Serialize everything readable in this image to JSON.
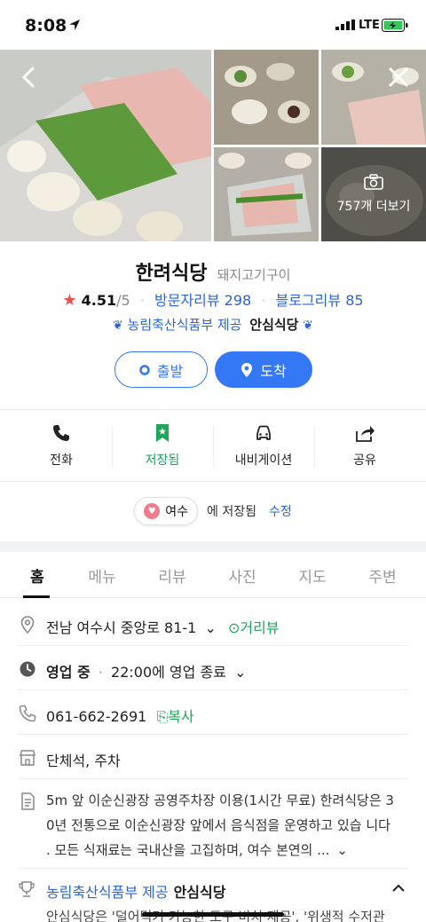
{
  "status_bar": {
    "time": "8:08",
    "network": "LTE"
  },
  "gallery": {
    "more_label": "757개 더보기"
  },
  "place": {
    "name": "한려식당",
    "category": "돼지고기구이",
    "rating": "4.51",
    "rating_max": "/5",
    "visitor_review_label": "방문자리뷰 298",
    "blog_review_label": "블로그리뷰 85",
    "cert_prefix": "농림축산식품부 제공",
    "cert_name": "안심식당"
  },
  "route_buttons": {
    "start": "출발",
    "arrive": "도착"
  },
  "actions": [
    {
      "label": "전화",
      "icon": "phone-icon"
    },
    {
      "label": "저장됨",
      "icon": "bookmark-icon"
    },
    {
      "label": "내비게이션",
      "icon": "car-icon"
    },
    {
      "label": "공유",
      "icon": "share-icon"
    }
  ],
  "saved": {
    "folder": "여수",
    "suffix": "에 저장됨",
    "edit": "수정"
  },
  "tabs": [
    "홈",
    "메뉴",
    "리뷰",
    "사진",
    "지도",
    "주변"
  ],
  "info": {
    "address": "전남 여수시 중앙로 81-1",
    "street_view": "거리뷰",
    "hours_status": "영업 중",
    "hours_detail": "22:00에 영업 종료",
    "phone": "061-662-2691",
    "copy": "복사",
    "facilities": "단체석, 주차",
    "description": [
      "5m 앞 이순신광장 공영주차장 이용(1시간 무료) 한려식당은 3",
      "0년 전통으로 이순신광장 앞에서 음식점을 운영하고 있습 니다",
      ". 모든 식재료는 국내산을 고집하며, 여수 본연의 ..."
    ],
    "cert_prefix": "농림축산식품부 제공",
    "cert_name": "안심식당",
    "cert_desc": "안심식당은 '덜어먹기 가능한 도구 비치·제공', '위생적 수저관"
  },
  "colors": {
    "accent": "#3478f6",
    "link": "#2b66d9",
    "green": "#1fa65a",
    "star": "#f24e4e"
  }
}
